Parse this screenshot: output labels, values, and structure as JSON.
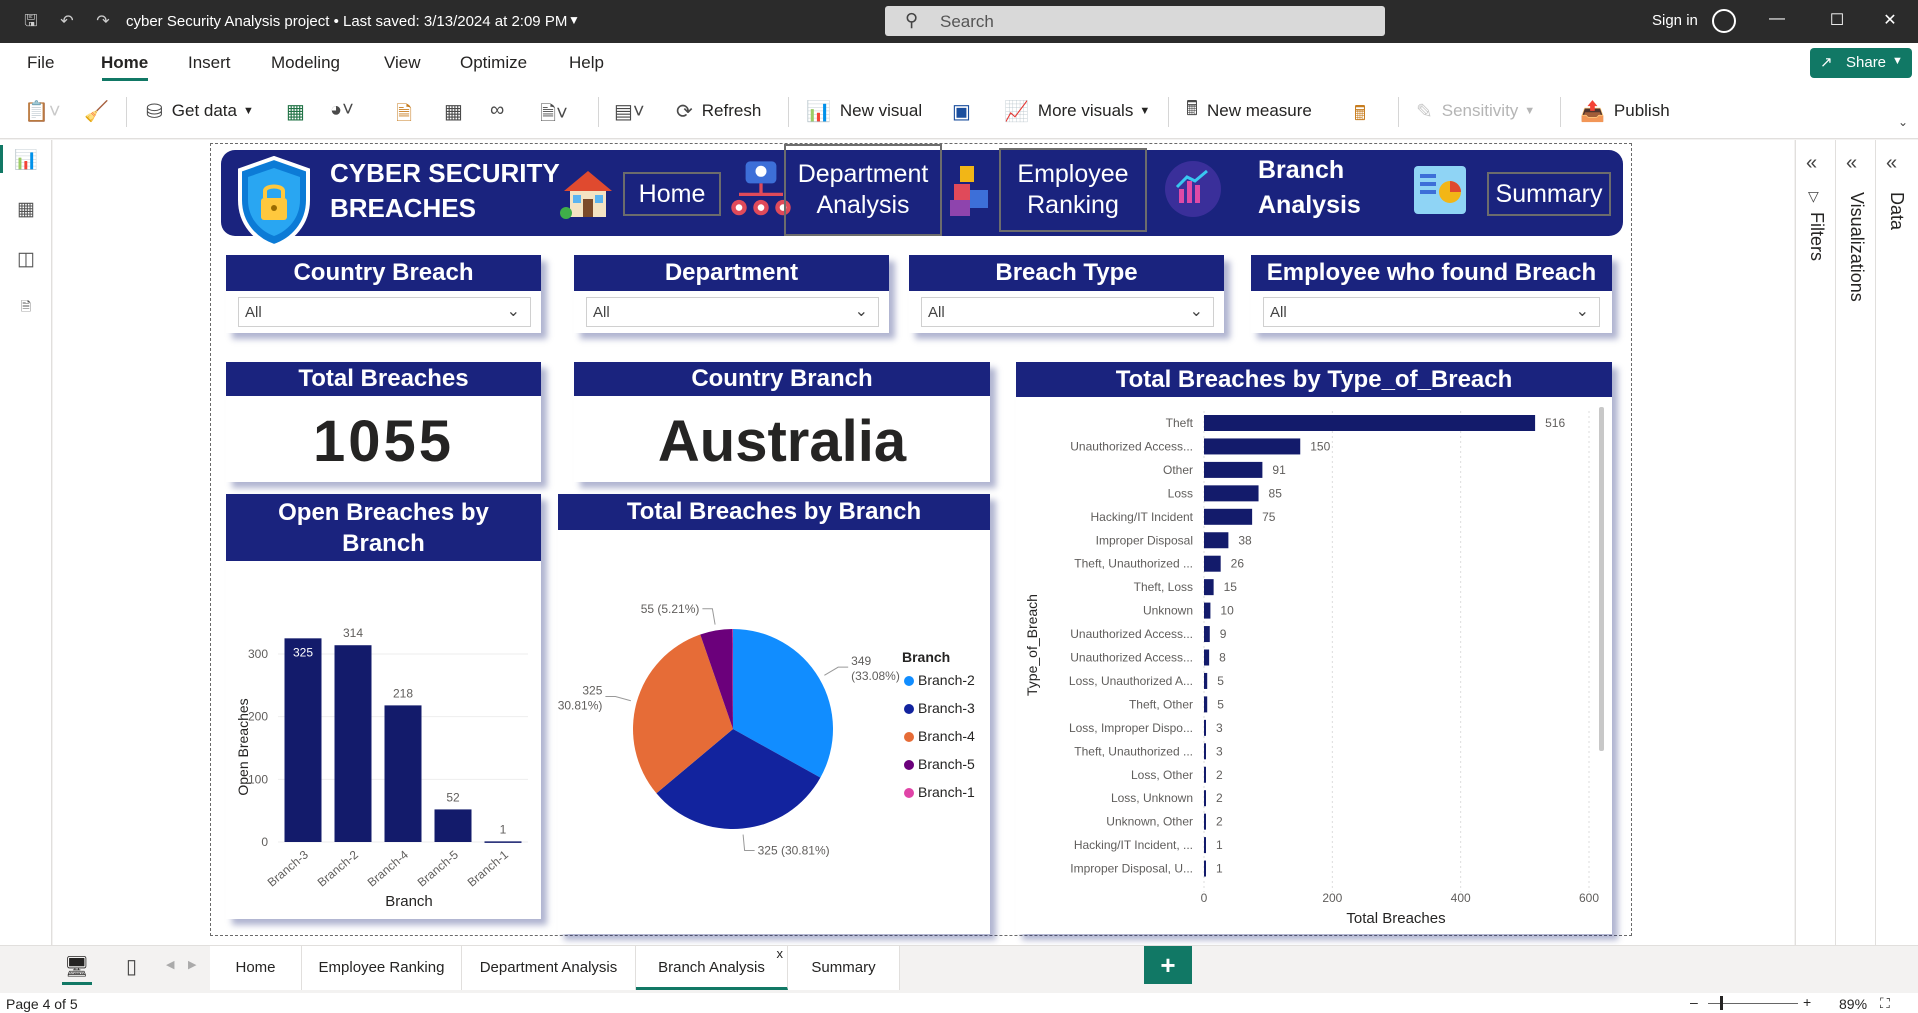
{
  "titlebar": {
    "document_title": "cyber Security Analysis project • Last saved: 3/13/2024 at 2:09 PM",
    "search_placeholder": "Search",
    "signin": "Sign in"
  },
  "menu": {
    "items": [
      "File",
      "Home",
      "Insert",
      "Modeling",
      "View",
      "Optimize",
      "Help"
    ],
    "active": "Home",
    "share": "Share"
  },
  "ribbon": {
    "get_data": "Get data",
    "refresh": "Refresh",
    "new_visual": "New visual",
    "more_visuals": "More visuals",
    "new_measure": "New measure",
    "sensitivity": "Sensitivity",
    "publish": "Publish"
  },
  "panes": {
    "filters": "Filters",
    "visualizations": "Visualizations",
    "data": "Data"
  },
  "banner": {
    "title_line1": "CYBER SECURITY",
    "title_line2": "BREACHES",
    "nav_home": "Home",
    "nav_department_1": "Department",
    "nav_department_2": "Analysis",
    "nav_employee_1": "Employee",
    "nav_employee_2": "Ranking",
    "nav_branch_1": "Branch",
    "nav_branch_2": "Analysis",
    "nav_summary": "Summary"
  },
  "slicers": [
    {
      "title": "Country Breach",
      "value": "All"
    },
    {
      "title": "Department",
      "value": "All"
    },
    {
      "title": "Breach Type",
      "value": "All"
    },
    {
      "title": "Employee who found Breach",
      "value": "All"
    }
  ],
  "kpis": {
    "total_breaches_title": "Total Breaches",
    "total_breaches_value": "1055",
    "country_branch_title": "Country Branch",
    "country_branch_value": "Australia"
  },
  "chart_titles": {
    "open_breaches_1": "Open Breaches by",
    "open_breaches_2": "Branch",
    "total_by_branch": "Total Breaches by Branch",
    "total_by_type": "Total Breaches by Type_of_Breach"
  },
  "chart_data": [
    {
      "type": "bar",
      "title": "Open Breaches by Branch",
      "xlabel": "Branch",
      "ylabel": "Open Breaches",
      "categories": [
        "Branch-3",
        "Branch-2",
        "Branch-4",
        "Branch-5",
        "Branch-1"
      ],
      "values": [
        325,
        314,
        218,
        52,
        1
      ],
      "ylim": [
        0,
        300
      ],
      "yticks": [
        0,
        100,
        200,
        300
      ],
      "color": "#131b6b"
    },
    {
      "type": "pie",
      "title": "Total Breaches by Branch",
      "legend_title": "Branch",
      "legend_position": "right",
      "slices": [
        {
          "name": "Branch-2",
          "value": 349,
          "label": "349 (33.08%)",
          "color": "#118dff"
        },
        {
          "name": "Branch-3",
          "value": 325,
          "label": "325 (30.81%)",
          "color": "#12239e"
        },
        {
          "name": "Branch-4",
          "value": 325,
          "label": "325 (30.81%)",
          "color": "#e66c37"
        },
        {
          "name": "Branch-5",
          "value": 55,
          "label": "55 (5.21%)",
          "color": "#6b007b"
        },
        {
          "name": "Branch-1",
          "value": 1,
          "label": "",
          "color": "#e044a7"
        }
      ]
    },
    {
      "type": "bar",
      "orientation": "horizontal",
      "title": "Total Breaches by Type_of_Breach",
      "xlabel": "Total Breaches",
      "ylabel": "Type_of_Breach",
      "xlim": [
        0,
        600
      ],
      "xticks": [
        0,
        200,
        400,
        600
      ],
      "color": "#131b6b",
      "categories": [
        "Theft",
        "Unauthorized Access...",
        "Other",
        "Loss",
        "Hacking/IT Incident",
        "Improper Disposal",
        "Theft, Unauthorized ...",
        "Theft, Loss",
        "Unknown",
        "Unauthorized Access...",
        "Unauthorized Access...",
        "Loss, Unauthorized A...",
        "Theft, Other",
        "Loss, Improper Dispo...",
        "Theft, Unauthorized ...",
        "Loss, Other",
        "Loss, Unknown",
        "Unknown, Other",
        "Hacking/IT Incident, ...",
        "Improper Disposal, U..."
      ],
      "values": [
        516,
        150,
        91,
        85,
        75,
        38,
        26,
        15,
        10,
        9,
        8,
        5,
        5,
        3,
        3,
        2,
        2,
        2,
        1,
        1
      ]
    }
  ],
  "tabs": [
    "Home",
    "Employee Ranking",
    "Department Analysis",
    "Branch Analysis",
    "Summary"
  ],
  "active_tab": "Branch Analysis",
  "status": {
    "page": "Page 4 of 5",
    "zoom": "89%"
  }
}
